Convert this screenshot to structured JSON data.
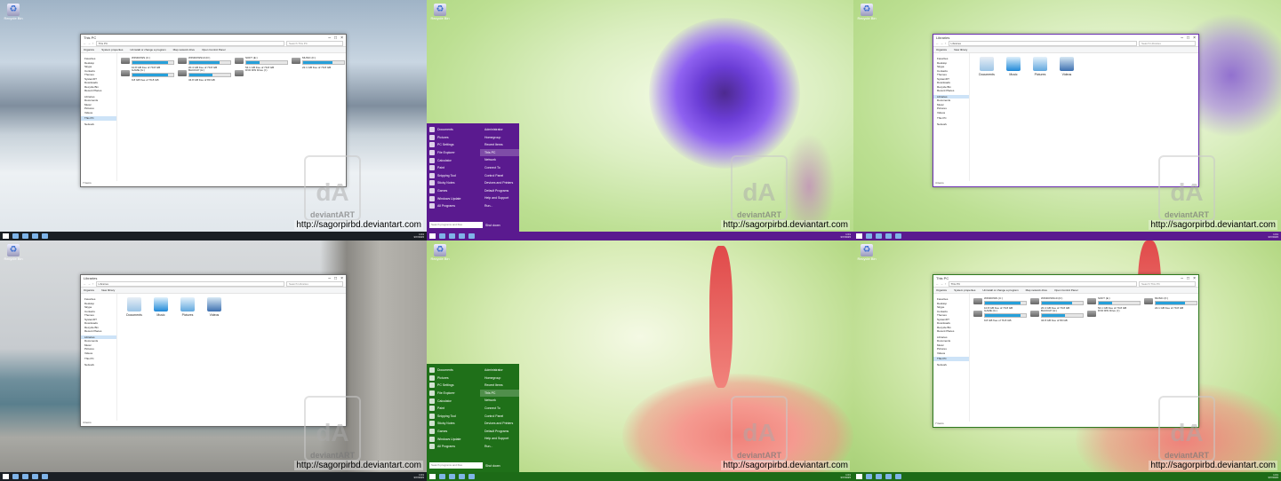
{
  "credit": "http://sagorpirbd.deviantart.com",
  "watermark": {
    "brand": "deviantART"
  },
  "desktop": {
    "recycle_label": "Recycle Bin"
  },
  "taskbar": {
    "time": "1:01",
    "date": "3/7/2015"
  },
  "explorer_pc": {
    "title": "This PC",
    "path": "This PC",
    "search_placeholder": "Search This PC",
    "commands": [
      "Organize",
      "System properties",
      "Uninstall or change a program",
      "Map network drive",
      "Open Control Panel"
    ],
    "nav": [
      "Favorites",
      "Desktop",
      "Skype",
      "Contacts",
      "Themes",
      "SystemDT",
      "Downloads",
      "Recycle Bin",
      "Recent Places",
      "Libraries",
      "Documents",
      "Music",
      "Pictures",
      "Videos",
      "This PC",
      "Network"
    ],
    "drives": [
      {
        "name": "WINDOWS (C:)",
        "free": "10.8 GB free of 79.8 GB",
        "fill": 0.86
      },
      {
        "name": "WINDOWS10 (D:)",
        "free": "20.4 GB free of 79.8 GB",
        "fill": 0.74
      },
      {
        "name": "SOFT (E:)",
        "free": "54.1 GB free of 79.8 GB",
        "fill": 0.32
      },
      {
        "name": "MUSIC (F:)",
        "free": "22.1 GB free of 79.8 GB",
        "fill": 0.72
      },
      {
        "name": "GAME (G:)",
        "free": "9.8 GB free of 79.8 GB",
        "fill": 0.88
      },
      {
        "name": "BACKUP (H:)",
        "free": "34.8 GB free of 80 GB",
        "fill": 0.56
      },
      {
        "name": "DVD RW Drive (I:)",
        "free": "",
        "fill": 0
      }
    ],
    "status": "7 items"
  },
  "explorer_lib": {
    "title": "Libraries",
    "path": "Libraries",
    "search_placeholder": "Search Libraries",
    "commands": [
      "Organize",
      "New library"
    ],
    "nav": [
      "Favorites",
      "Desktop",
      "Skype",
      "Contacts",
      "Themes",
      "SystemDT",
      "Downloads",
      "Recycle Bin",
      "Recent Places",
      "Libraries",
      "Documents",
      "Music",
      "Pictures",
      "Videos",
      "This PC",
      "Network"
    ],
    "items": [
      "Documents",
      "Music",
      "Pictures",
      "Videos"
    ],
    "status": "4 items"
  },
  "start": {
    "left": [
      "Documents",
      "Pictures",
      "PC Settings",
      "File Explorer",
      "Calculator",
      "Paint",
      "Snipping Tool",
      "Sticky Notes",
      "Games",
      "Windows Update"
    ],
    "all_programs": "All Programs",
    "search_placeholder": "Search programs and files",
    "right": [
      "Administrator",
      "Homegroup",
      "Recent Items",
      "This PC",
      "Network",
      "Connect To",
      "Control Panel",
      "Devices and Printers",
      "Default Programs",
      "Help and Support",
      "Run..."
    ],
    "shutdown": "Shut down"
  }
}
